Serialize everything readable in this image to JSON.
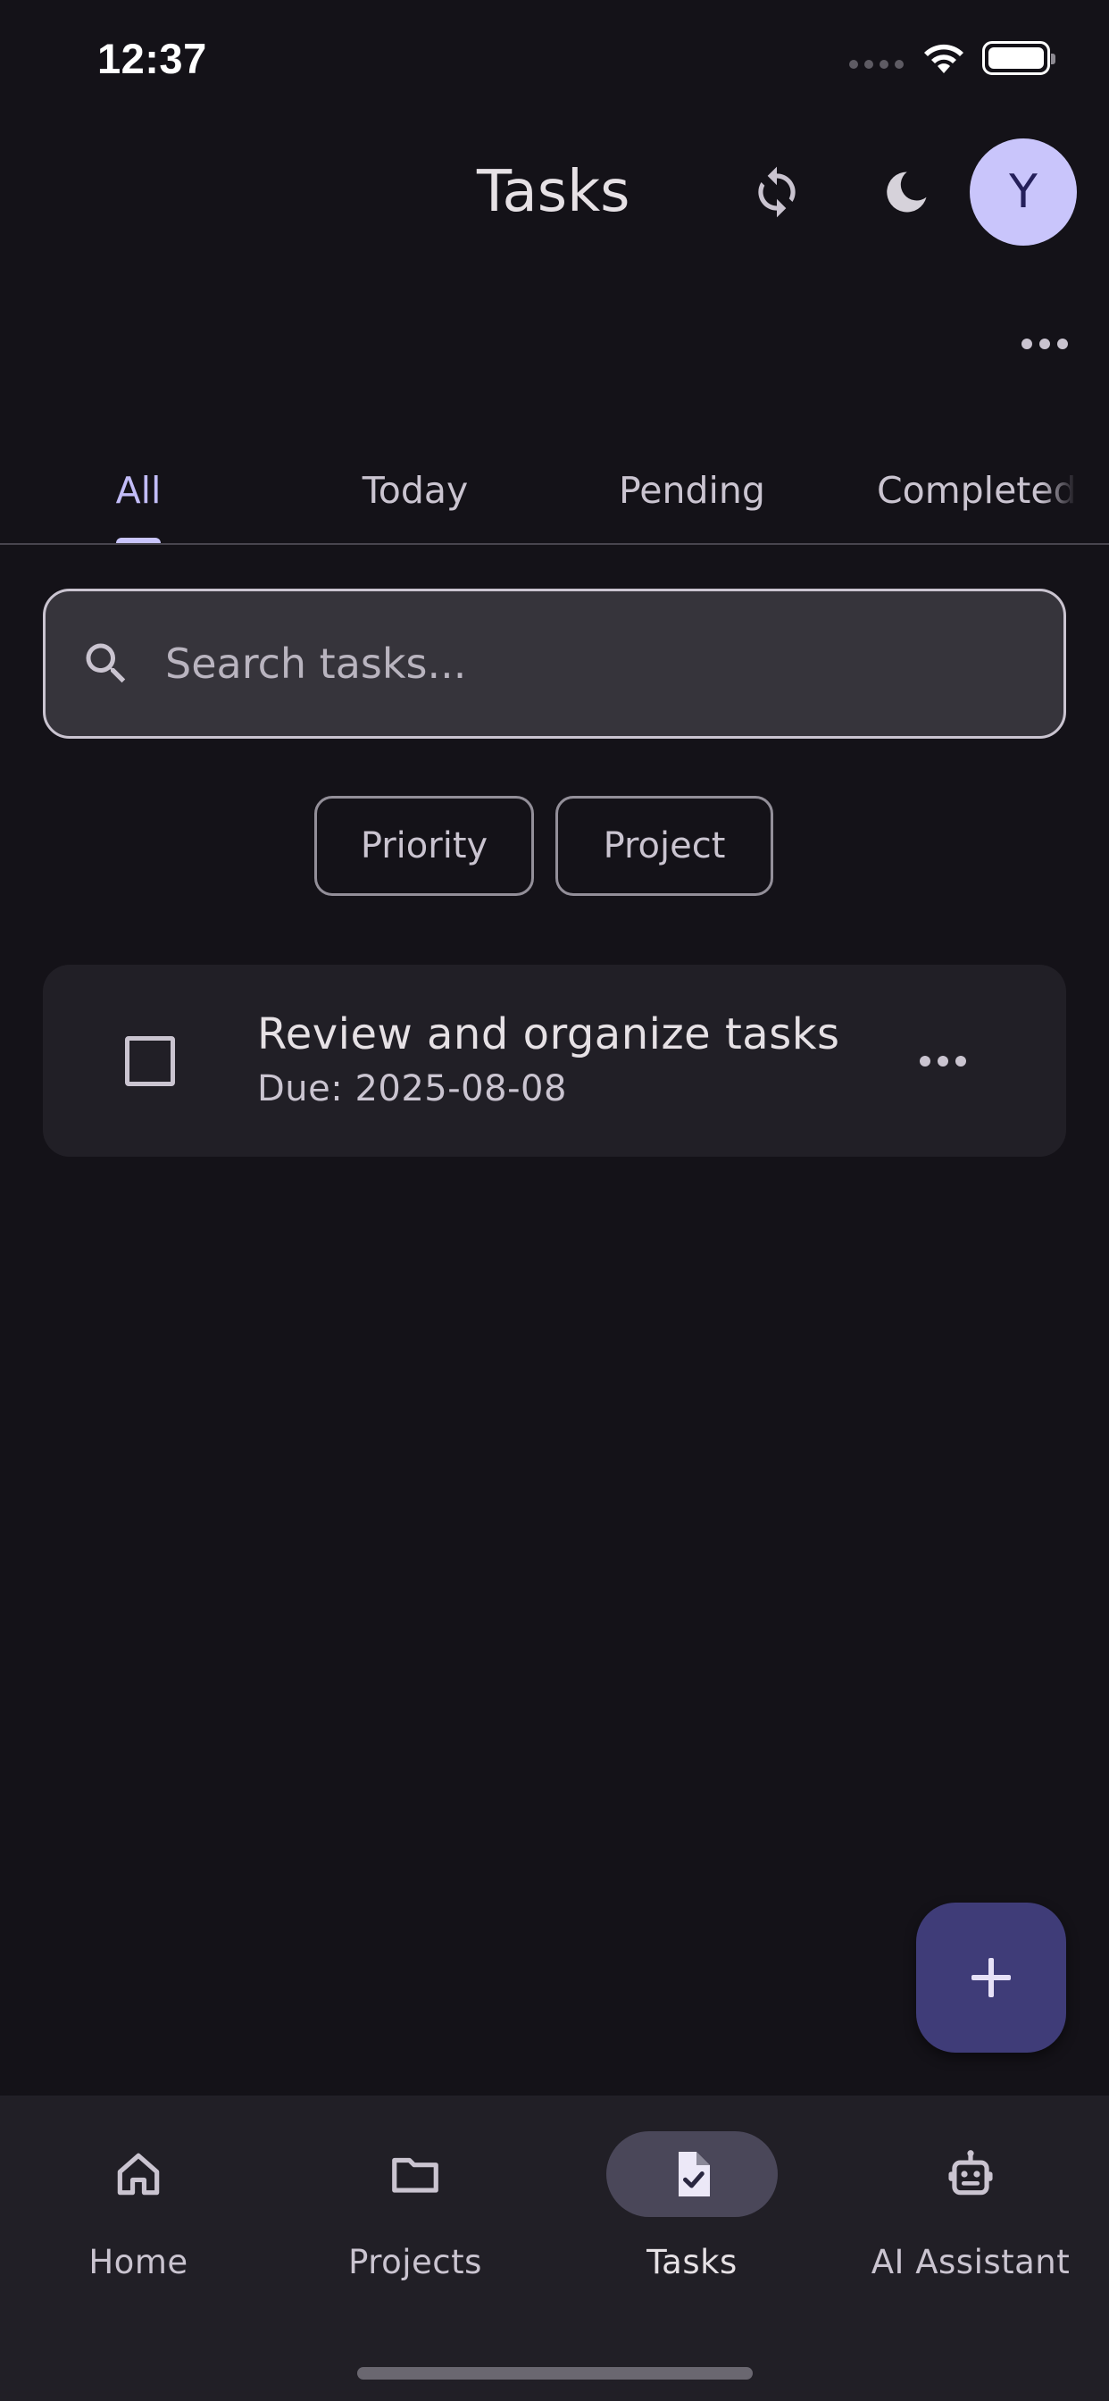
{
  "status_bar": {
    "time": "12:37"
  },
  "app_bar": {
    "title": "Tasks",
    "avatar_letter": "Y",
    "icons": [
      "sync-icon",
      "moon-icon",
      "more-horizontal-icon"
    ]
  },
  "tabs": [
    {
      "label": "All",
      "active": true
    },
    {
      "label": "Today",
      "active": false
    },
    {
      "label": "Pending",
      "active": false
    },
    {
      "label": "Completed",
      "active": false
    }
  ],
  "search": {
    "placeholder": "Search tasks...",
    "value": "",
    "icon": "search-icon"
  },
  "filters": [
    {
      "label": "Priority"
    },
    {
      "label": "Project"
    }
  ],
  "tasks": [
    {
      "title": "Review and organize tasks",
      "due": "Due: 2025-08-08",
      "completed": false
    }
  ],
  "fab": {
    "icon": "plus-icon"
  },
  "bottom_nav": [
    {
      "label": "Home",
      "icon": "home-icon",
      "active": false
    },
    {
      "label": "Projects",
      "icon": "folder-icon",
      "active": false
    },
    {
      "label": "Tasks",
      "icon": "task-document-icon",
      "active": true
    },
    {
      "label": "AI Assistant",
      "icon": "robot-icon",
      "active": false
    }
  ],
  "colors": {
    "background": "#141218",
    "surface": "#211f26",
    "accent": "#c9c5fb",
    "fab": "#3f3c78",
    "text": "#e6e1e5"
  }
}
